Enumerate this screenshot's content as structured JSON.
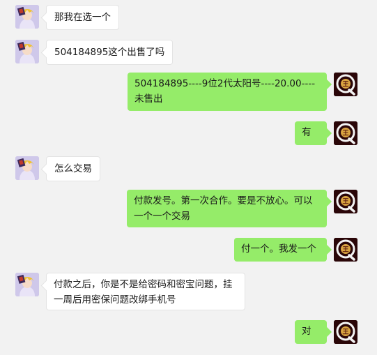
{
  "messages": [
    {
      "side": "left",
      "text": "那我在选一个"
    },
    {
      "side": "left",
      "text": "504184895这个出售了吗"
    },
    {
      "side": "right",
      "line1": "504184895----9位2代太阳号----20.00----",
      "line2": "未售出"
    },
    {
      "side": "right",
      "text": "有"
    },
    {
      "side": "left",
      "text": "怎么交易"
    },
    {
      "side": "right",
      "line1": "付款发号。第一次合作。要是不放心。可以",
      "line2": "一个一个交易"
    },
    {
      "side": "right",
      "text": "付一个。我发一个"
    },
    {
      "side": "left",
      "line1": "付款之后，你是不是给密码和密宝问题，挂",
      "line2": "一周后用密保问题改绑手机号"
    },
    {
      "side": "right",
      "text": "对"
    }
  ],
  "avatars": {
    "self_icon": "q-king-logo-icon",
    "self_badge_text": "王",
    "self_letter": "Q",
    "contact_icon": "anime-character-avatar",
    "colors": {
      "self_bg": "#2a0608",
      "self_ring": "#d9a441",
      "contact_bg": "#c9c4e6",
      "bubble_green": "#95ec69"
    }
  }
}
